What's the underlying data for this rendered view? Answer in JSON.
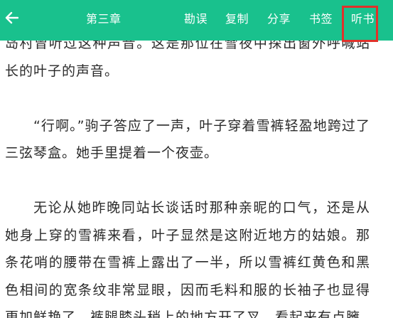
{
  "toolbar": {
    "chapter_title": "第三章",
    "menu": {
      "correct": "勘误",
      "copy": "复制",
      "share": "分享",
      "bookmark": "书签",
      "listen": "听书"
    },
    "background_color": "#19c18d",
    "highlight_color": "#e0312a"
  },
  "content": {
    "paragraphs": [
      "岛村曾听过这种声音。这是那位在雪夜中探出窗外呼喊站长的叶子的声音。",
      "“行啊。”驹子答应了一声，叶子穿着雪裤轻盈地跨过了三弦琴盒。她手里提着一个夜壶。",
      "无论从她昨晚同站长谈话时那种亲昵的口气，还是从她身上穿的雪裤来看，叶子显然是这附近地方的姑娘。那条花哨的腰带在雪裤上露出了一半，所以雪裤红黄色和黑色相间的宽条纹非常显眼，因而毛料和服的长袖子也显得更加鲜艳了。裤腿膝头稍上的地方开了叉，看起来有点臃"
    ]
  }
}
